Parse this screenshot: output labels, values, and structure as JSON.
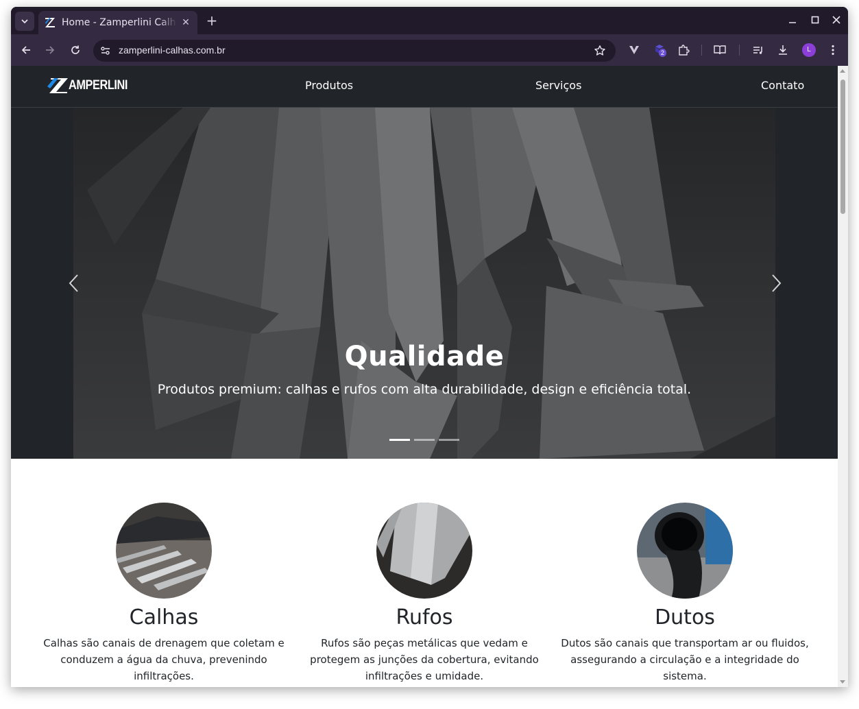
{
  "browser": {
    "tab_title": "Home - Zamperlini Calhas",
    "url": "zamperlini-calhas.com.br",
    "extension_badge": "2",
    "profile_initial": "L"
  },
  "site": {
    "logo_text": "AMPERLINI",
    "nav": [
      "Produtos",
      "Serviços",
      "Contato"
    ]
  },
  "hero": {
    "title": "Qualidade",
    "subtitle": "Produtos premium: calhas e rufos com alta durabilidade, design e eficiência total.",
    "slide_count": 3,
    "active_slide": 1
  },
  "products": [
    {
      "title": "Calhas",
      "text": "Calhas são canais de drenagem que coletam e conduzem a água da chuva, prevenindo infiltrações."
    },
    {
      "title": "Rufos",
      "text": "Rufos são peças metálicas que vedam e protegem as junções da cobertura, evitando infiltrações e umidade."
    },
    {
      "title": "Dutos",
      "text": "Dutos são canais que transportam ar ou fluidos, assegurando a circulação e a integridade do sistema."
    }
  ],
  "colors": {
    "browser_frame": "#211a2b",
    "toolbar": "#342b42",
    "navbar": "#212529",
    "logo_accent": "#1e88e5",
    "avatar": "#8c3fd6"
  }
}
